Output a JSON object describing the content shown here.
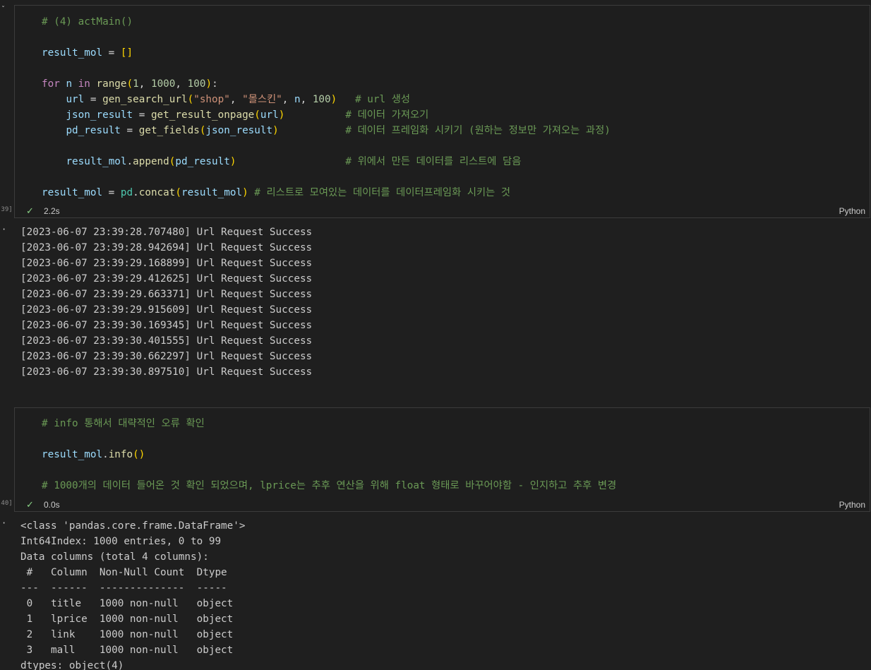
{
  "cells": [
    {
      "exec_count": "[39]",
      "exec_time": "2.2s",
      "language": "Python",
      "code_lines": [
        [
          {
            "t": "# (4) actMain()",
            "c": "comment"
          }
        ],
        [],
        [
          {
            "t": "result_mol",
            "c": "var"
          },
          {
            "t": " = ",
            "c": "plain"
          },
          {
            "t": "[]",
            "c": "bracket1"
          }
        ],
        [],
        [
          {
            "t": "for",
            "c": "kw"
          },
          {
            "t": " ",
            "c": "plain"
          },
          {
            "t": "n",
            "c": "var"
          },
          {
            "t": " ",
            "c": "plain"
          },
          {
            "t": "in",
            "c": "kw"
          },
          {
            "t": " ",
            "c": "plain"
          },
          {
            "t": "range",
            "c": "fn"
          },
          {
            "t": "(",
            "c": "bracket1"
          },
          {
            "t": "1",
            "c": "num"
          },
          {
            "t": ", ",
            "c": "plain"
          },
          {
            "t": "1000",
            "c": "num"
          },
          {
            "t": ", ",
            "c": "plain"
          },
          {
            "t": "100",
            "c": "num"
          },
          {
            "t": ")",
            "c": "bracket1"
          },
          {
            "t": ":",
            "c": "plain"
          }
        ],
        [
          {
            "t": "    ",
            "c": "plain"
          },
          {
            "t": "url",
            "c": "var"
          },
          {
            "t": " = ",
            "c": "plain"
          },
          {
            "t": "gen_search_url",
            "c": "fn"
          },
          {
            "t": "(",
            "c": "bracket1"
          },
          {
            "t": "\"shop\"",
            "c": "str"
          },
          {
            "t": ", ",
            "c": "plain"
          },
          {
            "t": "\"몰스킨\"",
            "c": "str"
          },
          {
            "t": ", ",
            "c": "plain"
          },
          {
            "t": "n",
            "c": "var"
          },
          {
            "t": ", ",
            "c": "plain"
          },
          {
            "t": "100",
            "c": "num"
          },
          {
            "t": ")",
            "c": "bracket1"
          },
          {
            "t": "   # url 생성",
            "c": "comment"
          }
        ],
        [
          {
            "t": "    ",
            "c": "plain"
          },
          {
            "t": "json_result",
            "c": "var"
          },
          {
            "t": " = ",
            "c": "plain"
          },
          {
            "t": "get_result_onpage",
            "c": "fn"
          },
          {
            "t": "(",
            "c": "bracket1"
          },
          {
            "t": "url",
            "c": "var"
          },
          {
            "t": ")",
            "c": "bracket1"
          },
          {
            "t": "          # 데이터 가져오기",
            "c": "comment"
          }
        ],
        [
          {
            "t": "    ",
            "c": "plain"
          },
          {
            "t": "pd_result",
            "c": "var"
          },
          {
            "t": " = ",
            "c": "plain"
          },
          {
            "t": "get_fields",
            "c": "fn"
          },
          {
            "t": "(",
            "c": "bracket1"
          },
          {
            "t": "json_result",
            "c": "var"
          },
          {
            "t": ")",
            "c": "bracket1"
          },
          {
            "t": "           # 데이터 프레임화 시키기 (원하는 정보만 가져오는 과정)",
            "c": "comment"
          }
        ],
        [],
        [
          {
            "t": "    ",
            "c": "plain"
          },
          {
            "t": "result_mol",
            "c": "var"
          },
          {
            "t": ".",
            "c": "plain"
          },
          {
            "t": "append",
            "c": "fn"
          },
          {
            "t": "(",
            "c": "bracket1"
          },
          {
            "t": "pd_result",
            "c": "var"
          },
          {
            "t": ")",
            "c": "bracket1"
          },
          {
            "t": "                  # 위에서 만든 데이터를 리스트에 담음",
            "c": "comment"
          }
        ],
        [],
        [
          {
            "t": "result_mol",
            "c": "var"
          },
          {
            "t": " = ",
            "c": "plain"
          },
          {
            "t": "pd",
            "c": "builtin"
          },
          {
            "t": ".",
            "c": "plain"
          },
          {
            "t": "concat",
            "c": "fn"
          },
          {
            "t": "(",
            "c": "bracket1"
          },
          {
            "t": "result_mol",
            "c": "var"
          },
          {
            "t": ")",
            "c": "bracket1"
          },
          {
            "t": " # 리스트로 모여있는 데이터를 데이터프레임화 시키는 것",
            "c": "comment"
          }
        ]
      ],
      "output_lines": [
        "[2023-06-07 23:39:28.707480] Url Request Success",
        "[2023-06-07 23:39:28.942694] Url Request Success",
        "[2023-06-07 23:39:29.168899] Url Request Success",
        "[2023-06-07 23:39:29.412625] Url Request Success",
        "[2023-06-07 23:39:29.663371] Url Request Success",
        "[2023-06-07 23:39:29.915609] Url Request Success",
        "[2023-06-07 23:39:30.169345] Url Request Success",
        "[2023-06-07 23:39:30.401555] Url Request Success",
        "[2023-06-07 23:39:30.662297] Url Request Success",
        "[2023-06-07 23:39:30.897510] Url Request Success"
      ]
    },
    {
      "exec_count": "[40]",
      "exec_time": "0.0s",
      "language": "Python",
      "code_lines": [
        [
          {
            "t": "# info 통해서 대략적인 오류 확인",
            "c": "comment"
          }
        ],
        [],
        [
          {
            "t": "result_mol",
            "c": "var"
          },
          {
            "t": ".",
            "c": "plain"
          },
          {
            "t": "info",
            "c": "fn"
          },
          {
            "t": "()",
            "c": "bracket1"
          }
        ],
        [],
        [
          {
            "t": "# 1000개의 데이터 들어온 것 확인 되었으며, lprice는 추후 연산을 위해 float 형태로 바꾸어야함 - 인지하고 추후 변경",
            "c": "comment"
          }
        ]
      ],
      "output_lines": [
        "<class 'pandas.core.frame.DataFrame'>",
        "Int64Index: 1000 entries, 0 to 99",
        "Data columns (total 4 columns):",
        " #   Column  Non-Null Count  Dtype ",
        "---  ------  --------------  ----- ",
        " 0   title   1000 non-null   object",
        " 1   lprice  1000 non-null   object",
        " 2   link    1000 non-null   object",
        " 3   mall    1000 non-null   object",
        "dtypes: object(4)"
      ]
    }
  ],
  "icons": {
    "success": "check-icon",
    "collapse": "chevron-down-icon",
    "output_menu": "ellipsis-icon"
  },
  "colors": {
    "success": "#89d185"
  }
}
